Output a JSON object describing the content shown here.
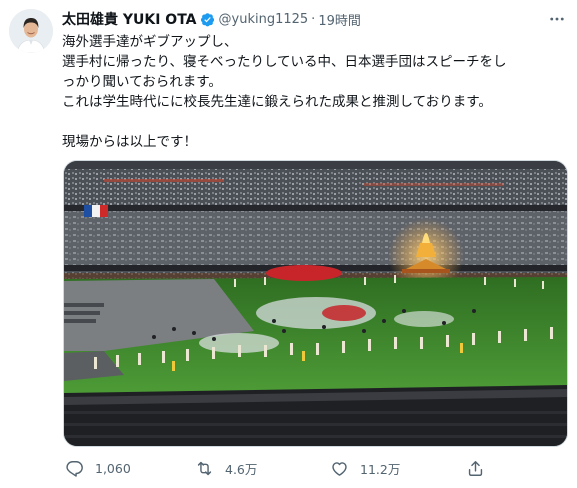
{
  "tweet": {
    "author": {
      "display_name": "太田雄貴 YUKI OTA",
      "handle": "@yuking1125",
      "verified": true,
      "verified_color": "#1d9bf0"
    },
    "separator": "·",
    "time": "19時間",
    "text_lines": [
      "海外選手達がギブアップし、",
      "選手村に帰ったり、寝そべったりしている中、日本選手団はスピーチをし",
      "っかり聞いておられます。",
      "これは学生時代にに校長先生達に鍛えられた成果と推測しております。",
      "",
      "現場からは以上です！"
    ],
    "media": {
      "scene": "night-stadium-closing-ceremony-photo",
      "field_color": "#3f8f2e",
      "cauldron_color": "#f2b03a"
    },
    "actions": {
      "reply": {
        "icon": "reply-icon",
        "count": "1,060"
      },
      "retweet": {
        "icon": "retweet-icon",
        "count": "4.6万"
      },
      "like": {
        "icon": "heart-icon",
        "count": "11.2万"
      },
      "share": {
        "icon": "share-icon"
      }
    },
    "colors": {
      "text": "#0f1419",
      "secondary": "#536471",
      "accent": "#1d9bf0"
    }
  }
}
